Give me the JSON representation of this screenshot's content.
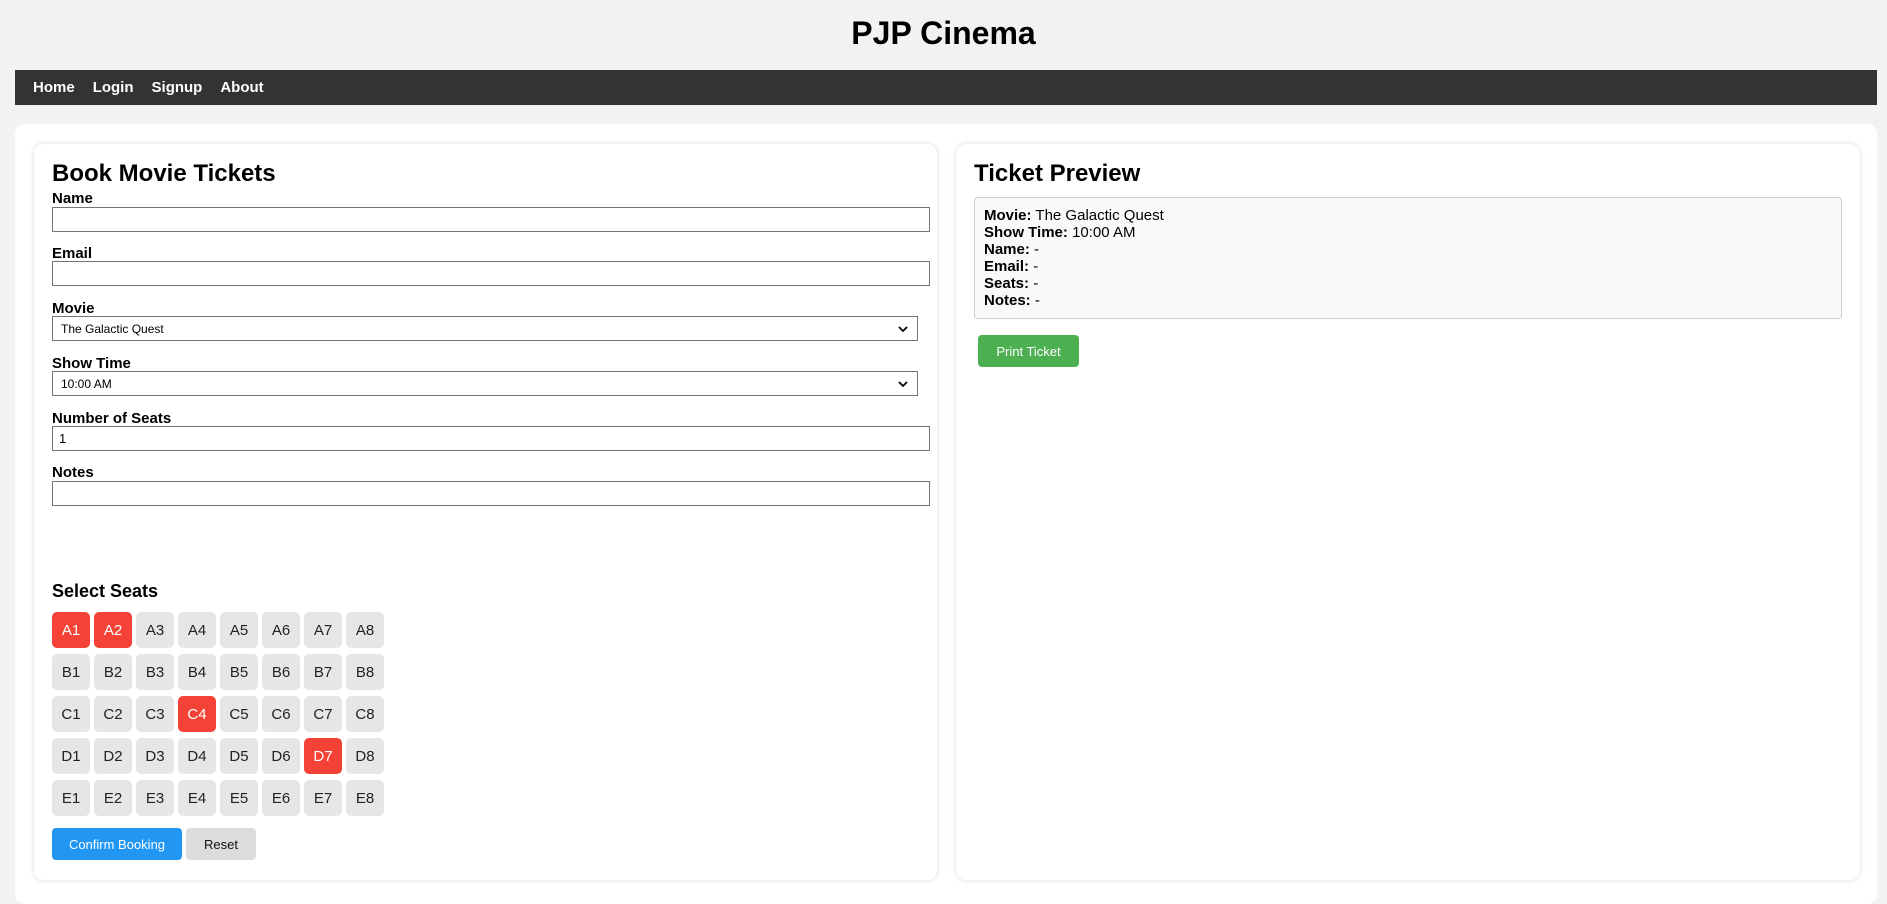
{
  "site": {
    "title": "PJP Cinema"
  },
  "nav": {
    "items": [
      {
        "label": "Home"
      },
      {
        "label": "Login"
      },
      {
        "label": "Signup"
      },
      {
        "label": "About"
      }
    ]
  },
  "booking": {
    "heading": "Book Movie Tickets",
    "name": {
      "label": "Name",
      "value": ""
    },
    "email": {
      "label": "Email",
      "value": ""
    },
    "movie": {
      "label": "Movie",
      "selected": "The Galactic Quest"
    },
    "showtime": {
      "label": "Show Time",
      "selected": "10:00 AM"
    },
    "seats_count": {
      "label": "Number of Seats",
      "value": "1"
    },
    "notes": {
      "label": "Notes",
      "value": ""
    },
    "seat_section_title": "Select Seats",
    "seat_rows": [
      {
        "row": "A",
        "seats": [
          "A1",
          "A2",
          "A3",
          "A4",
          "A5",
          "A6",
          "A7",
          "A8"
        ]
      },
      {
        "row": "B",
        "seats": [
          "B1",
          "B2",
          "B3",
          "B4",
          "B5",
          "B6",
          "B7",
          "B8"
        ]
      },
      {
        "row": "C",
        "seats": [
          "C1",
          "C2",
          "C3",
          "C4",
          "C5",
          "C6",
          "C7",
          "C8"
        ]
      },
      {
        "row": "D",
        "seats": [
          "D1",
          "D2",
          "D3",
          "D4",
          "D5",
          "D6",
          "D7",
          "D8"
        ]
      },
      {
        "row": "E",
        "seats": [
          "E1",
          "E2",
          "E3",
          "E4",
          "E5",
          "E6",
          "E7",
          "E8"
        ]
      }
    ],
    "booked_seats": [
      "A1",
      "A2",
      "C4",
      "D7"
    ],
    "confirm_label": "Confirm Booking",
    "reset_label": "Reset"
  },
  "preview": {
    "heading": "Ticket Preview",
    "lines": [
      {
        "key": "Movie:",
        "value": "The Galactic Quest"
      },
      {
        "key": "Show Time:",
        "value": "10:00 AM"
      },
      {
        "key": "Name:",
        "value": "-"
      },
      {
        "key": "Email:",
        "value": "-"
      },
      {
        "key": "Seats:",
        "value": "-"
      },
      {
        "key": "Notes:",
        "value": "-"
      }
    ],
    "print_label": "Print Ticket"
  },
  "colors": {
    "navbar": "#333333",
    "booked_seat": "#f44336",
    "free_seat": "#e6e6e6",
    "confirm_button": "#2196F3",
    "print_button": "#4CAF50"
  }
}
